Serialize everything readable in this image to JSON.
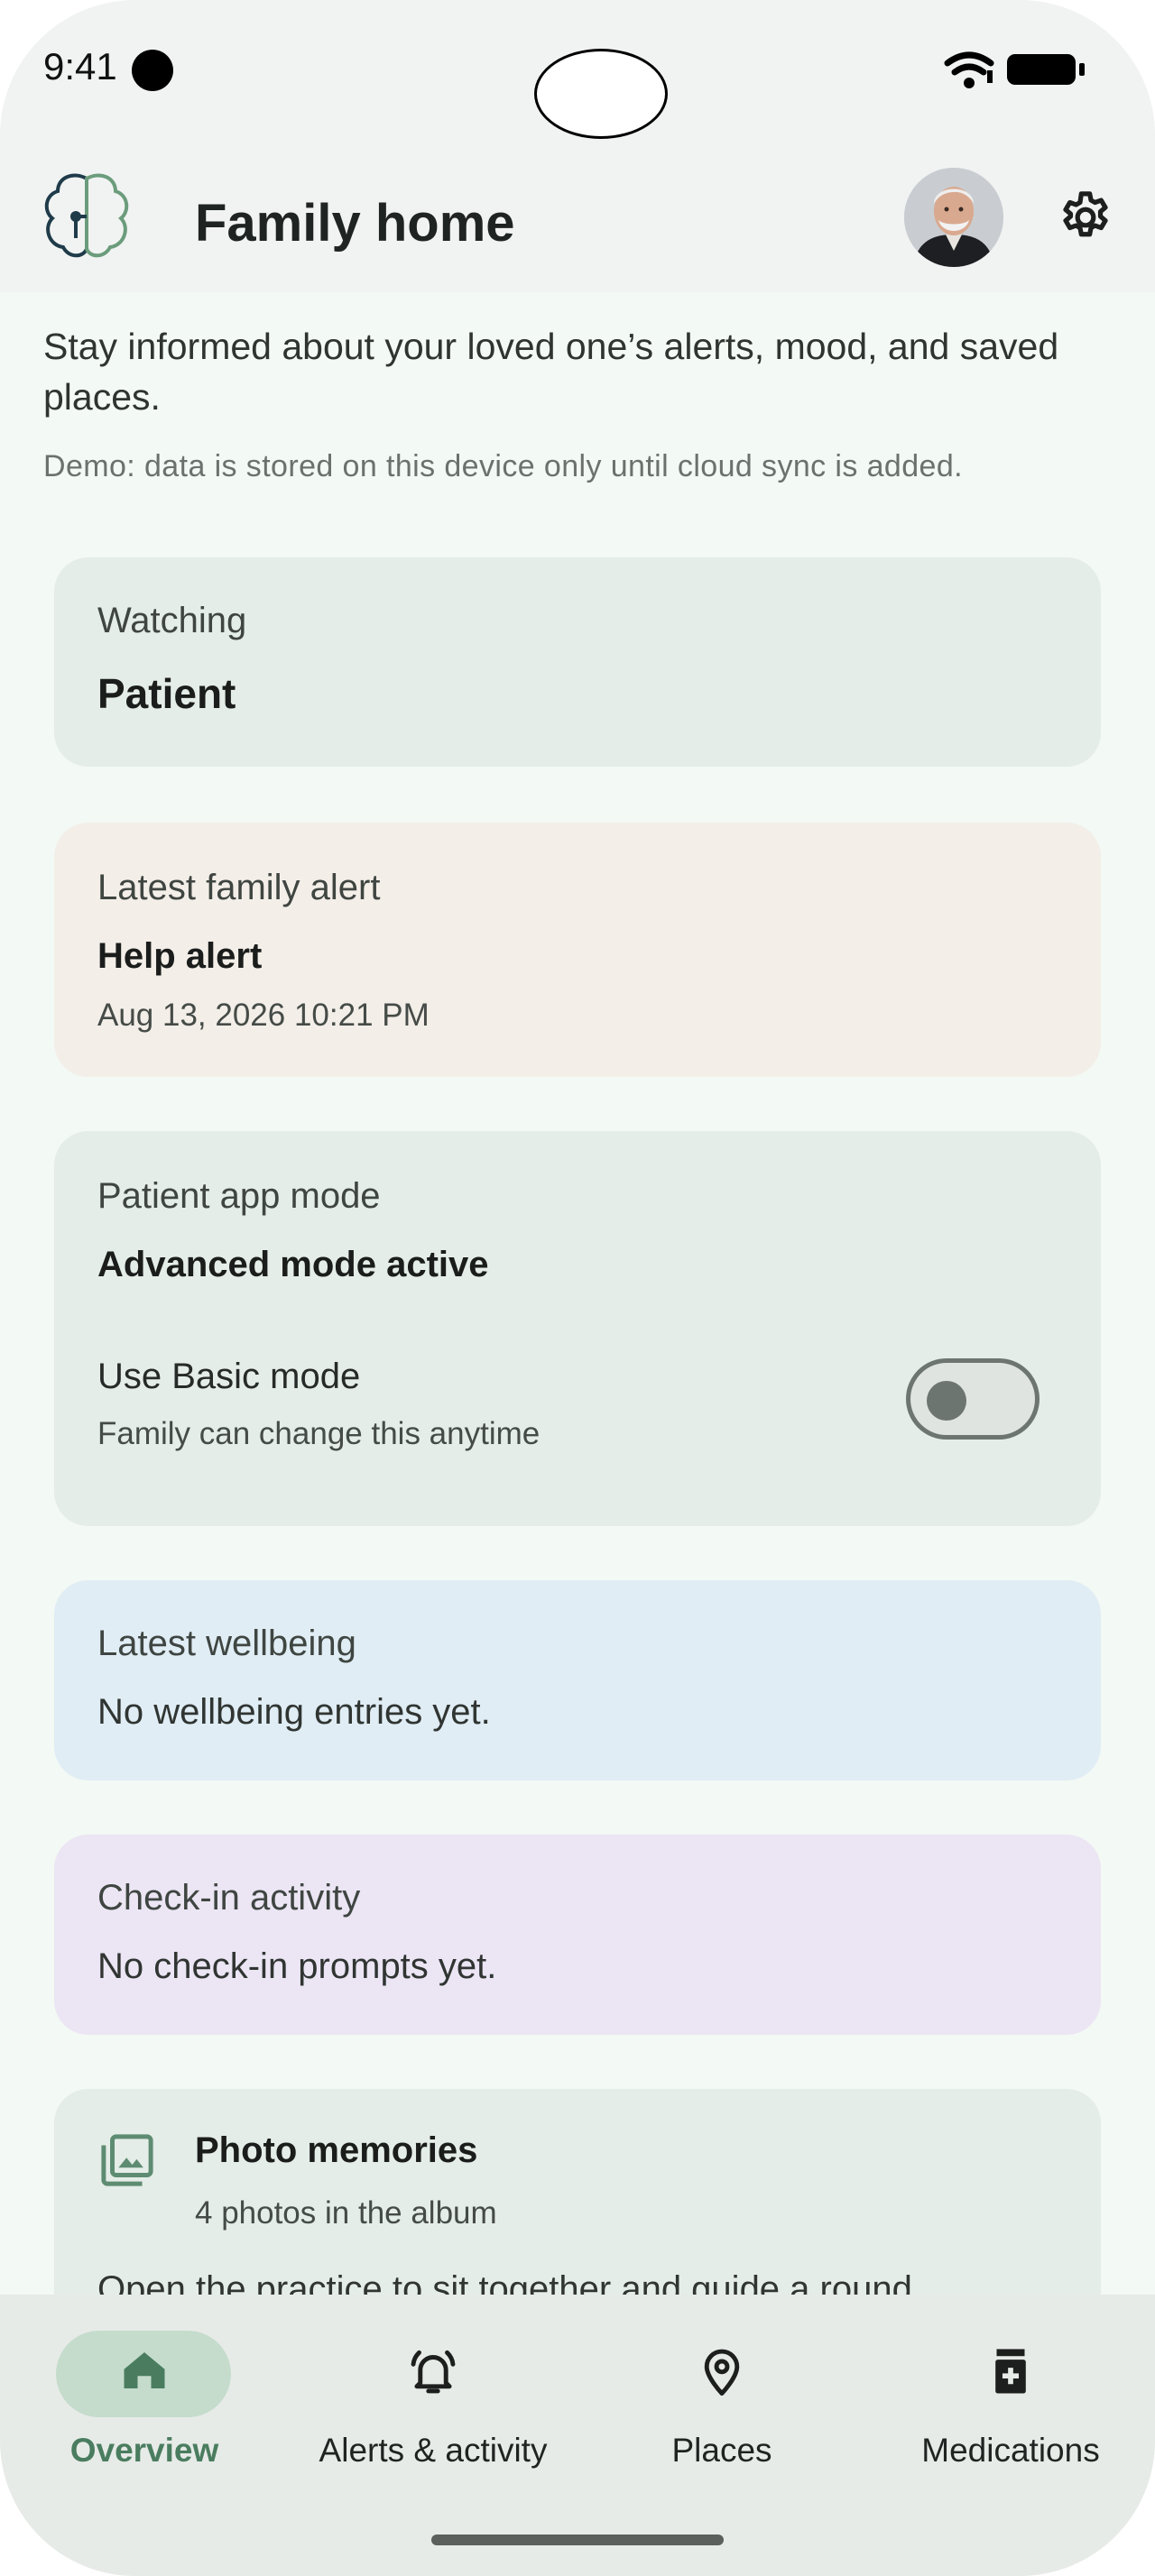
{
  "status_bar": {
    "time": "9:41"
  },
  "app_bar": {
    "title": "Family home"
  },
  "intro": {
    "description": "Stay informed about your loved one’s alerts, mood, and saved places.",
    "demo_note": "Demo: data is stored on this device only until cloud sync is added."
  },
  "cards": {
    "watching": {
      "label": "Watching",
      "name": "Patient"
    },
    "alert": {
      "label": "Latest family alert",
      "title": "Help alert",
      "timestamp": "Aug 13, 2026 10:21 PM"
    },
    "mode": {
      "label": "Patient app mode",
      "status": "Advanced mode active",
      "toggle_label": "Use Basic mode",
      "toggle_sub": "Family can change this anytime",
      "toggle_on": false
    },
    "wellbeing": {
      "label": "Latest wellbeing",
      "text": "No wellbeing entries yet."
    },
    "checkin": {
      "label": "Check-in activity",
      "text": "No check-in prompts yet."
    },
    "photos": {
      "title": "Photo memories",
      "subtitle": "4 photos in the album",
      "text": "Open the practice to sit together and guide a round."
    }
  },
  "bottom_nav": {
    "items": [
      {
        "label": "Overview",
        "icon": "home-icon",
        "active": true
      },
      {
        "label": "Alerts & activity",
        "icon": "bell-alert-icon",
        "active": false
      },
      {
        "label": "Places",
        "icon": "map-pin-icon",
        "active": false
      },
      {
        "label": "Medications",
        "icon": "pill-bottle-icon",
        "active": false
      }
    ]
  },
  "colors": {
    "accent": "#4a7d5f",
    "nav_active_pill": "#c5dccd",
    "card_green": "#e5ede8",
    "card_beige": "#f3eee8",
    "card_blue": "#e0edf5",
    "card_purple": "#ebe5f4",
    "page_bg": "#f3f9f4"
  }
}
